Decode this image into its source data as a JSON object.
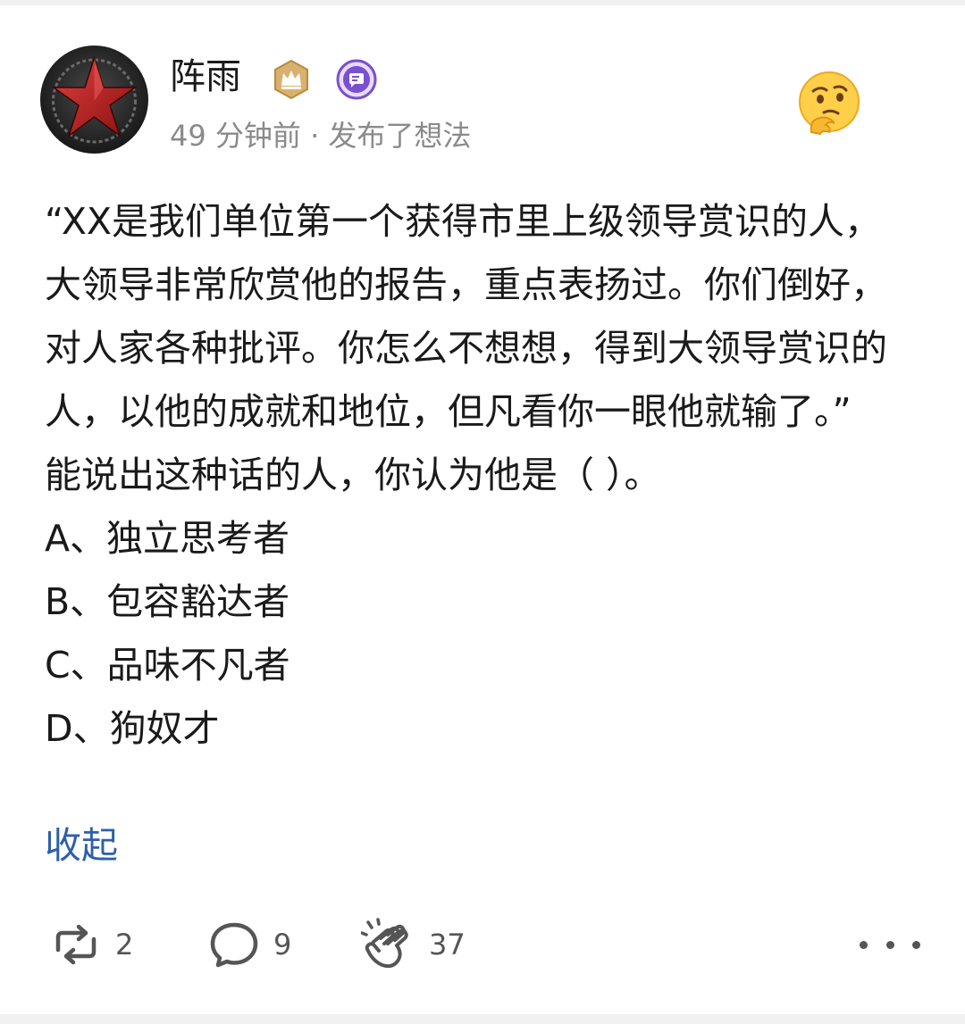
{
  "post": {
    "author": {
      "name": "阵雨",
      "avatar_icon": "red-star-icon",
      "badges": [
        "crown-badge-icon",
        "comment-badge-icon"
      ]
    },
    "meta": "49 分钟前 · 发布了想法",
    "reaction_icon": "thinking-face-emoji",
    "paragraphs": [
      "“XX是我们单位第一个获得市里上级领导赏识的人，大领导非常欣赏他的报告，重点表扬过。你们倒好，对人家各种批评。你怎么不想想，得到大领导赏识的人，以他的成就和地位，但凡看你一眼他就输了。”",
      "能说出这种话的人，你认为他是（ ）。",
      "A、独立思考者",
      "B、包容豁达者",
      "C、品味不凡者",
      "D、狗奴才"
    ],
    "collapse_label": "收起"
  },
  "actions": {
    "repost_count": "2",
    "comment_count": "9",
    "clap_count": "37"
  },
  "colors": {
    "link": "#2e5fa8",
    "text": "#1a1a1a",
    "meta": "#8a8a8a",
    "crown_badge": "#c99a4e",
    "comment_badge": "#7a4fd0"
  }
}
